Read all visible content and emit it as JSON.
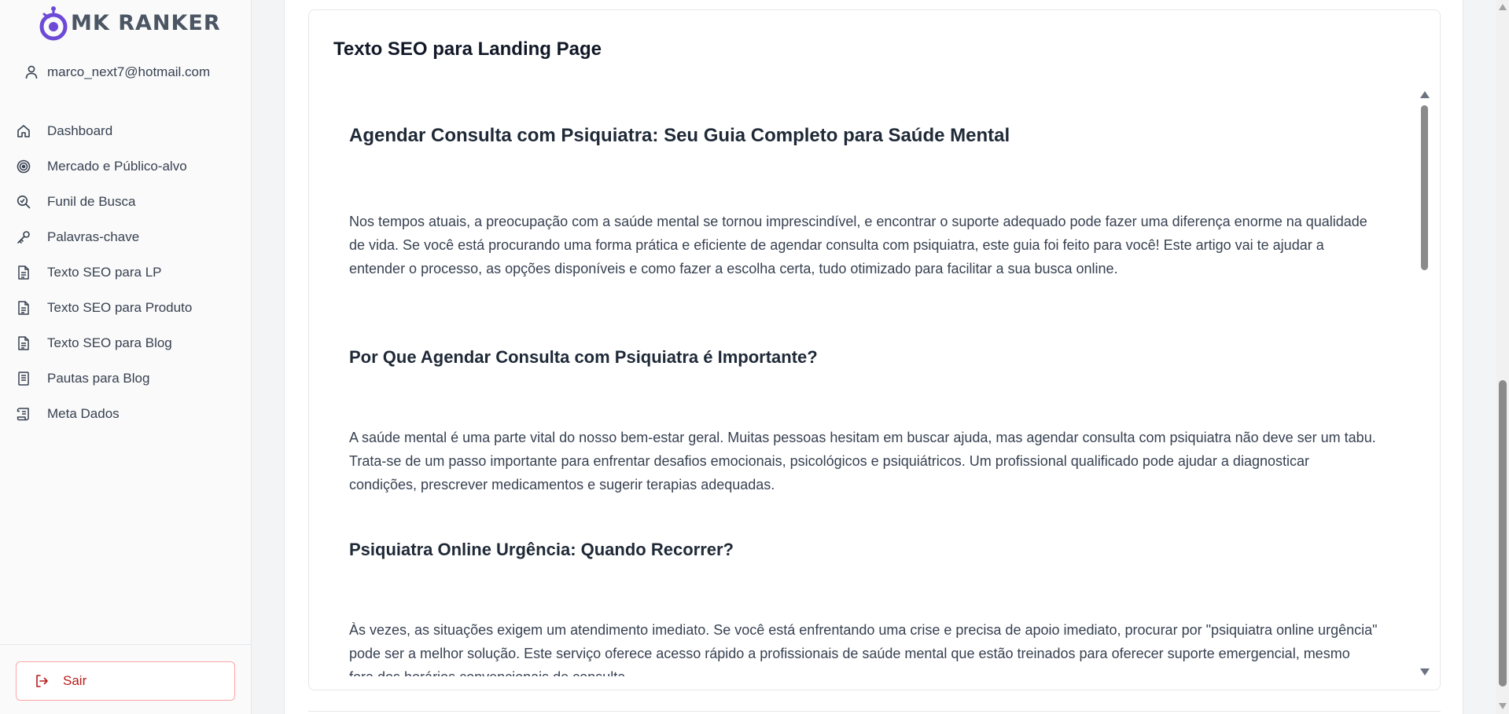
{
  "brand": {
    "name": "MK RANKER",
    "accent": "#6d4ad6"
  },
  "user": {
    "email": "marco_next7@hotmail.com"
  },
  "nav": [
    {
      "label": "Dashboard",
      "icon": "home-icon"
    },
    {
      "label": "Mercado e Público-alvo",
      "icon": "target-icon"
    },
    {
      "label": "Funil de Busca",
      "icon": "search-zoom-icon"
    },
    {
      "label": "Palavras-chave",
      "icon": "key-icon"
    },
    {
      "label": "Texto SEO para LP",
      "icon": "document-icon"
    },
    {
      "label": "Texto SEO para Produto",
      "icon": "document-icon"
    },
    {
      "label": "Texto SEO para Blog",
      "icon": "document-icon"
    },
    {
      "label": "Pautas para Blog",
      "icon": "notebook-icon"
    },
    {
      "label": "Meta Dados",
      "icon": "scroll-icon"
    }
  ],
  "logout": {
    "label": "Sair",
    "color": "#b91c1c"
  },
  "card": {
    "title": "Texto SEO para Landing Page"
  },
  "article": {
    "h1": "Agendar Consulta com Psiquiatra: Seu Guia Completo para Saúde Mental",
    "p1": "Nos tempos atuais, a preocupação com a saúde mental se tornou imprescindível, e encontrar o suporte adequado pode fazer uma diferença enorme na qualidade de vida. Se você está procurando uma forma prática e eficiente de agendar consulta com psiquiatra, este guia foi feito para você! Este artigo vai te ajudar a entender o processo, as opções disponíveis e como fazer a escolha certa, tudo otimizado para facilitar a sua busca online.",
    "h2": "Por Que Agendar Consulta com Psiquiatra é Importante?",
    "p2": "A saúde mental é uma parte vital do nosso bem-estar geral. Muitas pessoas hesitam em buscar ajuda, mas agendar consulta com psiquiatra não deve ser um tabu. Trata-se de um passo importante para enfrentar desafios emocionais, psicológicos e psiquiátricos. Um profissional qualificado pode ajudar a diagnosticar condições, prescrever medicamentos e sugerir terapias adequadas.",
    "h3": "Psiquiatra Online Urgência: Quando Recorrer?",
    "p3": "Às vezes, as situações exigem um atendimento imediato. Se você está enfrentando uma crise e precisa de apoio imediato, procurar por \"psiquiatra online urgência\" pode ser a melhor solução. Este serviço oferece acesso rápido a profissionais de saúde mental que estão treinados para oferecer suporte emergencial, mesmo fora dos horários convencionais de consulta."
  }
}
